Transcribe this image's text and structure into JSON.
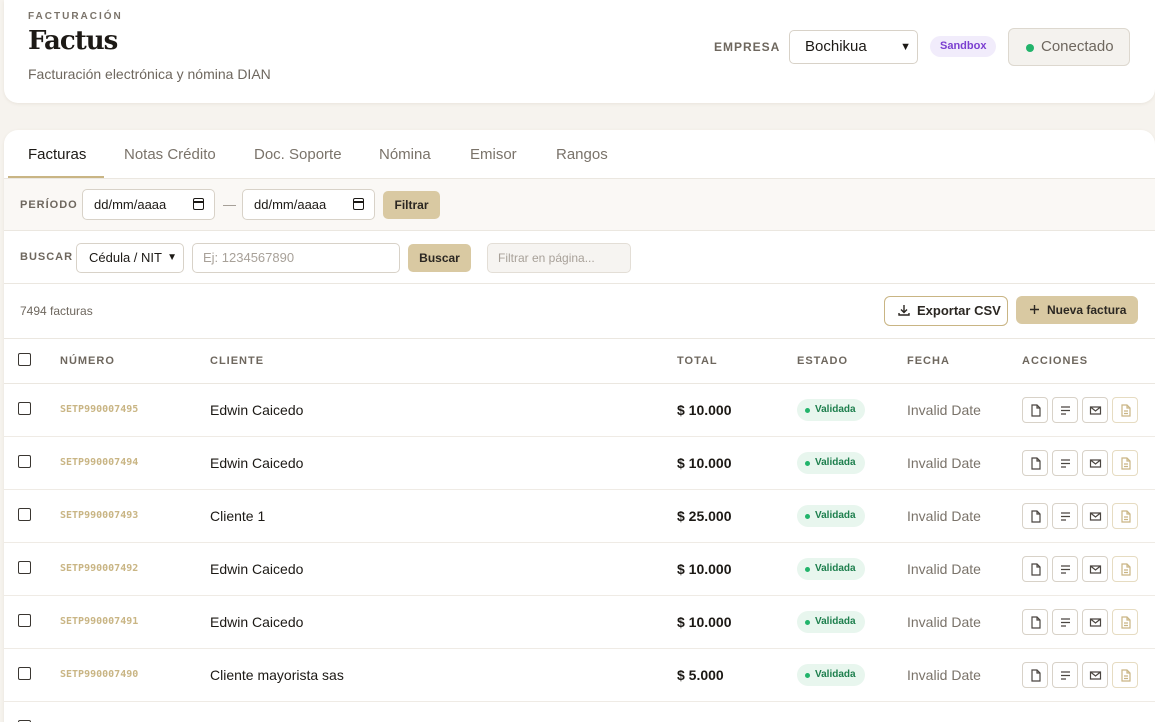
{
  "header": {
    "eyebrow": "FACTURACIÓN",
    "brand": "Factus",
    "subtitle": "Facturación electrónica y nómina DIAN",
    "empresa_label": "EMPRESA",
    "empresa_value": "Bochikua",
    "env_badge": "Sandbox",
    "connection_status": "Conectado",
    "colors": {
      "status_green": "#22b46b",
      "sandbox_purple": "#7b3fd0"
    }
  },
  "tabs": [
    "Facturas",
    "Notas Crédito",
    "Doc. Soporte",
    "Nómina",
    "Emisor",
    "Rangos"
  ],
  "active_tab": "Facturas",
  "filter": {
    "periodo_label": "PERÍODO",
    "date_from_placeholder": "dd/mm/aaaa",
    "date_to_placeholder": "dd/mm/aaaa",
    "separator": "—",
    "filter_button": "Filtrar"
  },
  "search": {
    "label": "BUSCAR",
    "type_value": "Cédula / NIT",
    "input_placeholder": "Ej: 1234567890",
    "search_button": "Buscar",
    "page_filter_placeholder": "Filtrar en página..."
  },
  "toolbar": {
    "count": "7494 facturas",
    "export_button": "Exportar CSV",
    "new_button": "Nueva factura"
  },
  "table": {
    "columns": [
      "NÚMERO",
      "CLIENTE",
      "TOTAL",
      "ESTADO",
      "FECHA",
      "ACCIONES"
    ],
    "rows": [
      {
        "numero": "SETP990007495",
        "cliente": "Edwin Caicedo",
        "total": "$ 10.000",
        "estado": "Validada",
        "fecha": "Invalid Date"
      },
      {
        "numero": "SETP990007494",
        "cliente": "Edwin Caicedo",
        "total": "$ 10.000",
        "estado": "Validada",
        "fecha": "Invalid Date"
      },
      {
        "numero": "SETP990007493",
        "cliente": "Cliente 1",
        "total": "$ 25.000",
        "estado": "Validada",
        "fecha": "Invalid Date"
      },
      {
        "numero": "SETP990007492",
        "cliente": "Edwin Caicedo",
        "total": "$ 10.000",
        "estado": "Validada",
        "fecha": "Invalid Date"
      },
      {
        "numero": "SETP990007491",
        "cliente": "Edwin Caicedo",
        "total": "$ 10.000",
        "estado": "Validada",
        "fecha": "Invalid Date"
      },
      {
        "numero": "SETP990007490",
        "cliente": "Cliente mayorista sas",
        "total": "$ 5.000",
        "estado": "Validada",
        "fecha": "Invalid Date"
      }
    ],
    "row_actions": [
      "pdf-icon",
      "detail-lines-icon",
      "email-icon",
      "xml-document-icon"
    ]
  }
}
